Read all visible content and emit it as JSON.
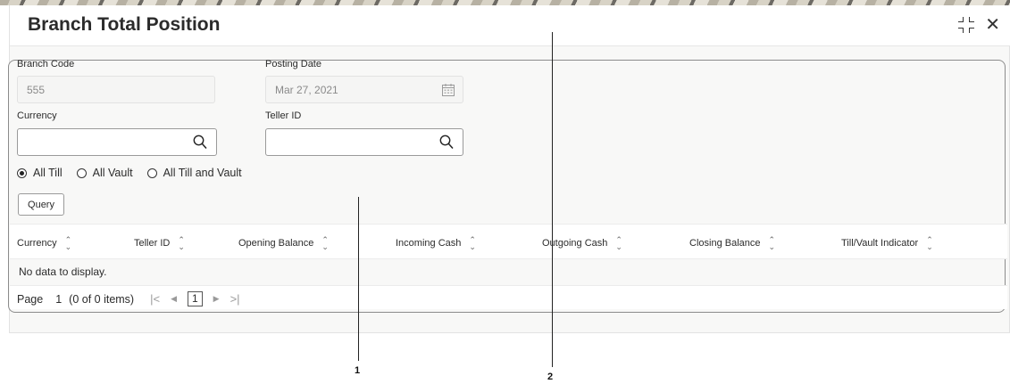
{
  "header": {
    "title": "Branch Total Position"
  },
  "fields": {
    "branch_code": {
      "label": "Branch Code",
      "value": "555"
    },
    "posting_date": {
      "label": "Posting Date",
      "value": "Mar 27, 2021"
    },
    "currency": {
      "label": "Currency",
      "value": ""
    },
    "teller_id": {
      "label": "Teller ID",
      "value": ""
    }
  },
  "radios": [
    {
      "label": "All Till",
      "checked": true
    },
    {
      "label": "All Vault",
      "checked": false
    },
    {
      "label": "All Till and Vault",
      "checked": false
    }
  ],
  "query_label": "Query",
  "table": {
    "columns": [
      "Currency",
      "Teller ID",
      "Opening Balance",
      "Incoming Cash",
      "Outgoing Cash",
      "Closing Balance",
      "Till/Vault Indicator"
    ],
    "empty_text": "No data to display."
  },
  "pagination": {
    "page_label": "Page",
    "page": "1",
    "items": "(0 of 0 items)",
    "current": "1"
  },
  "callouts": [
    "1",
    "2"
  ]
}
